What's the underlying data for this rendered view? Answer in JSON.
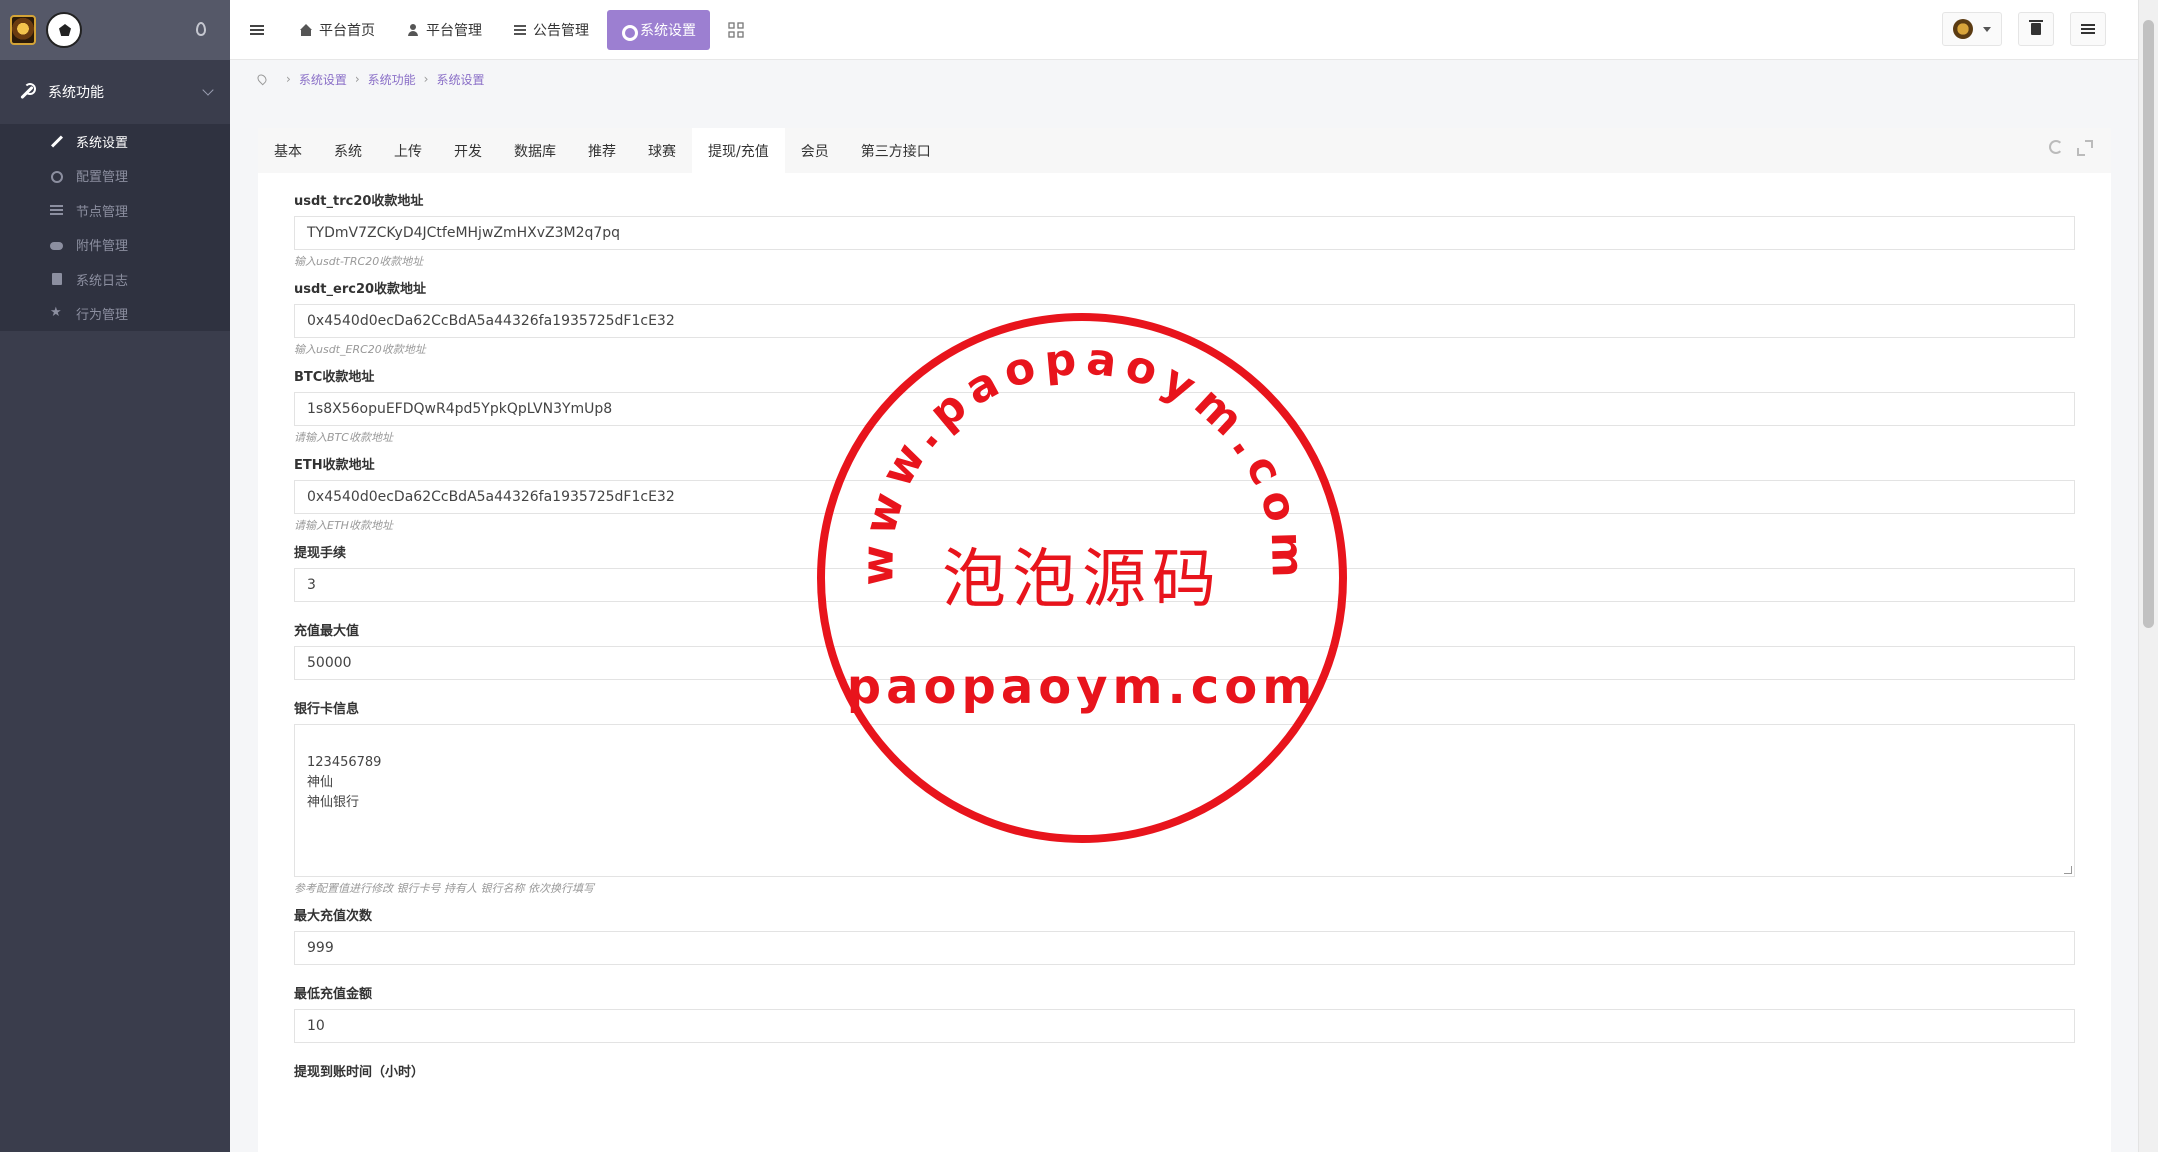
{
  "sidebar": {
    "group_label": "系统功能",
    "items": [
      {
        "label": "系统设置",
        "icon": "wrench-icon",
        "active": true
      },
      {
        "label": "配置管理",
        "icon": "cogs-icon"
      },
      {
        "label": "节点管理",
        "icon": "bars-icon"
      },
      {
        "label": "附件管理",
        "icon": "cloud-icon"
      },
      {
        "label": "系统日志",
        "icon": "book-icon"
      },
      {
        "label": "行为管理",
        "icon": "star-icon"
      }
    ]
  },
  "topnav": {
    "items": [
      {
        "label": "平台首页",
        "icon": "home-icon"
      },
      {
        "label": "平台管理",
        "icon": "user-icon"
      },
      {
        "label": "公告管理",
        "icon": "list-icon"
      },
      {
        "label": "系统设置",
        "icon": "gear-icon",
        "active": true
      }
    ]
  },
  "breadcrumb": [
    "系统设置",
    "系统功能",
    "系统设置"
  ],
  "tabs": [
    "基本",
    "系统",
    "上传",
    "开发",
    "数据库",
    "推荐",
    "球赛",
    "提现/充值",
    "会员",
    "第三方接口"
  ],
  "active_tab": "提现/充值",
  "fields": {
    "usdt_trc20": {
      "label": "usdt_trc20收款地址",
      "value": "TYDmV7ZCKyD4JCtfeMHjwZmHXvZ3M2q7pq",
      "help": "输入usdt-TRC20收款地址"
    },
    "usdt_erc20": {
      "label": "usdt_erc20收款地址",
      "value": "0x4540d0ecDa62CcBdA5a44326fa1935725dF1cE32",
      "help": "输入usdt_ERC20收款地址"
    },
    "btc": {
      "label": "BTC收款地址",
      "value": "1s8X56opuEFDQwR4pd5YpkQpLVN3YmUp8",
      "help": "请输入BTC收款地址"
    },
    "eth": {
      "label": "ETH收款地址",
      "value": "0x4540d0ecDa62CcBdA5a44326fa1935725dF1cE32",
      "help": "请输入ETH收款地址"
    },
    "fee": {
      "label": "提现手续",
      "value": "3"
    },
    "max_recharge": {
      "label": "充值最大值",
      "value": "50000"
    },
    "bank_card": {
      "label": "银行卡信息",
      "value": "123456789\n神仙\n神仙银行",
      "help": "参考配置值进行修改 银行卡号 持有人 银行名称 依次换行填写"
    },
    "max_times": {
      "label": "最大充值次数",
      "value": "999"
    },
    "min_amount": {
      "label": "最低充值金额",
      "value": "10"
    },
    "withdraw_time": {
      "label": "提现到账时间（小时）"
    }
  },
  "stamp": {
    "arc_text": "www.paopaoym.com",
    "center_text": "泡泡源码",
    "bottom_text": "paopaoym.com",
    "color": "#e8141c"
  },
  "colors": {
    "accent": "#9c7fd1",
    "sidebar": "#3a3d4c"
  }
}
